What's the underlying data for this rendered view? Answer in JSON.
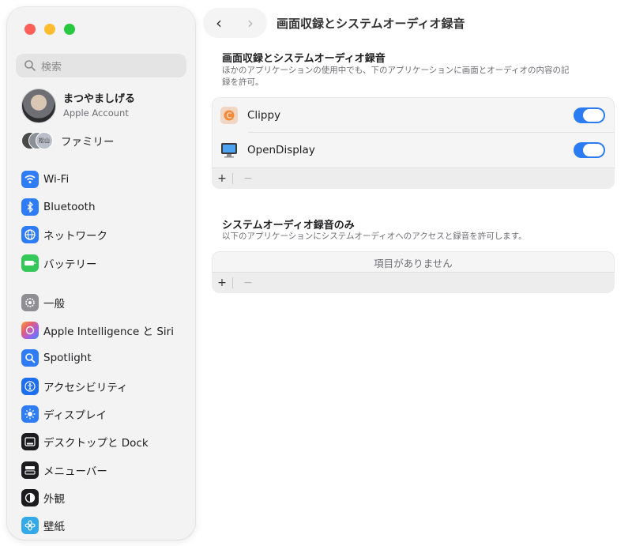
{
  "window": {
    "title": "画面収録とシステムオーディオ録音"
  },
  "sidebar": {
    "search_placeholder": "検索",
    "account": {
      "name": "まつやましげる",
      "subtitle": "Apple Account"
    },
    "family": {
      "label": "ファミリー",
      "avatar_text": "松山"
    },
    "items": [
      {
        "label": "Wi-Fi",
        "icon": "wifi-icon",
        "color": "#2e7cf6"
      },
      {
        "label": "Bluetooth",
        "icon": "bluetooth-icon",
        "color": "#2e7cf6"
      },
      {
        "label": "ネットワーク",
        "icon": "globe-icon",
        "color": "#2e7cf6"
      },
      {
        "label": "バッテリー",
        "icon": "battery-icon",
        "color": "#34c759"
      },
      {
        "label": "一般",
        "icon": "gear-icon",
        "color": "#8e8e93"
      },
      {
        "label": "Apple Intelligence と Siri",
        "icon": "siri-icon",
        "color": "#e85d75"
      },
      {
        "label": "Spotlight",
        "icon": "magnifier-icon",
        "color": "#2e7cf6"
      },
      {
        "label": "アクセシビリティ",
        "icon": "accessibility-icon",
        "color": "#1d6ff0"
      },
      {
        "label": "ディスプレイ",
        "icon": "sun-icon",
        "color": "#2e7cf6"
      },
      {
        "label": "デスクトップと Dock",
        "icon": "dock-icon",
        "color": "#1c1c1e"
      },
      {
        "label": "メニューバー",
        "icon": "menubar-icon",
        "color": "#1c1c1e"
      },
      {
        "label": "外観",
        "icon": "appearance-icon",
        "color": "#1c1c1e"
      },
      {
        "label": "壁紙",
        "icon": "wallpaper-icon",
        "color": "#35a8e8"
      }
    ]
  },
  "section1": {
    "title": "画面収録とシステムオーディオ録音",
    "description": "ほかのアプリケーションの使用中でも、下のアプリケーションに画面とオーディオの内容の記録を許可。",
    "apps": [
      {
        "name": "Clippy",
        "enabled": true
      },
      {
        "name": "OpenDisplay",
        "enabled": true
      }
    ],
    "add_label": "+",
    "remove_label": "−"
  },
  "section2": {
    "title": "システムオーディオ録音のみ",
    "description": "以下のアプリケーションにシステムオーディオへのアクセスと録音を許可します。",
    "empty_text": "項目がありません",
    "add_label": "+",
    "remove_label": "−"
  },
  "toolbar": {
    "back_label": "‹",
    "forward_label": "›"
  },
  "colors": {
    "accent": "#2b7bf3"
  }
}
